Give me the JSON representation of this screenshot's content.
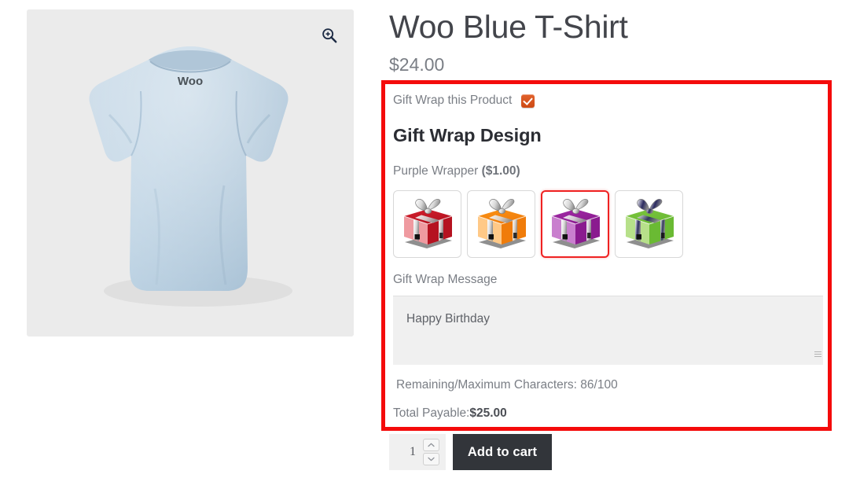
{
  "product": {
    "title": "Woo Blue T-Shirt",
    "price": "$24.00",
    "image_alt": "Woo Blue T-Shirt back view",
    "shirt_brand_mark": "Woo",
    "zoom_icon": "magnifier-plus-icon"
  },
  "giftwrap": {
    "checkbox_label": "Gift Wrap this Product",
    "checkbox_checked": true,
    "heading": "Gift Wrap Design",
    "selected_wrapper_name": "Purple Wrapper",
    "selected_wrapper_price": "($1.00)",
    "designs": [
      {
        "name": "Red Wrapper",
        "box_light": "#ef9aa0",
        "box_dark": "#b51220",
        "box_top": "#d4202e",
        "ribbon": "#d9d9d9",
        "selected": false
      },
      {
        "name": "Orange Wrapper",
        "box_light": "#ffc987",
        "box_dark": "#f07c0a",
        "box_top": "#fb9214",
        "ribbon": "#d9d9d9",
        "selected": false
      },
      {
        "name": "Purple Wrapper",
        "box_light": "#c97fce",
        "box_dark": "#8a1b8f",
        "box_top": "#a32aa8",
        "ribbon": "#d9d9d9",
        "selected": true
      },
      {
        "name": "Green Wrapper",
        "box_light": "#b7e08a",
        "box_dark": "#6aba33",
        "box_top": "#7cc53e",
        "ribbon": "#2b2a60",
        "selected": false
      }
    ],
    "message_label": "Gift Wrap Message",
    "message_value": "Happy Birthday",
    "message_placeholder": "",
    "char_counter": "Remaining/Maximum Characters: 86/100",
    "total_label": "Total Payable:",
    "total_amount": "$25.00",
    "highlight_color": "#f40b0b"
  },
  "cart": {
    "quantity": "1",
    "increase_label": "Increase quantity",
    "decrease_label": "Decrease quantity",
    "add_to_cart_label": "Add to cart"
  }
}
